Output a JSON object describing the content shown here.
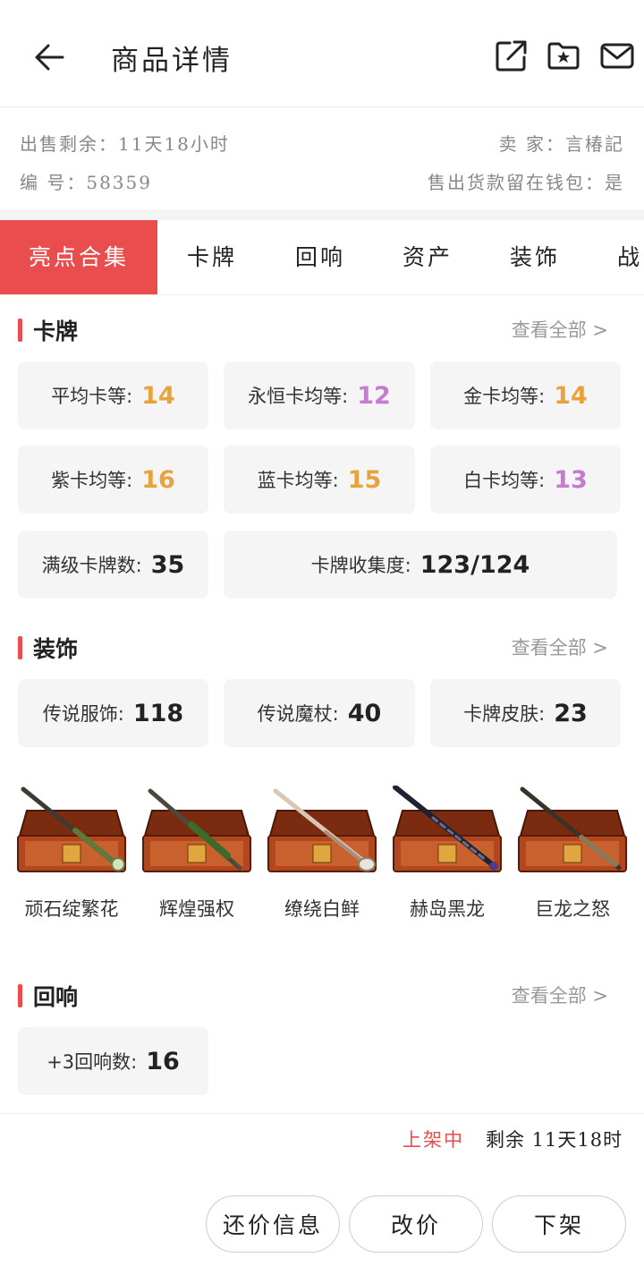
{
  "header": {
    "title": "商品详情"
  },
  "info": {
    "remaining": "出售剩余：11天18小时",
    "seller": "卖 家：言椿記",
    "number": "编 号：58359",
    "wallet": "售出货款留在钱包：是"
  },
  "tabs": [
    "亮点合集",
    "卡牌",
    "回响",
    "资产",
    "装饰",
    "战"
  ],
  "cards_section": {
    "title": "卡牌",
    "more": "查看全部 >",
    "stats": [
      {
        "label": "平均卡等:",
        "value": "14",
        "color": "#e8a33d"
      },
      {
        "label": "永恒卡均等:",
        "value": "12",
        "color": "#c67bd0"
      },
      {
        "label": "金卡均等:",
        "value": "14",
        "color": "#e8a33d"
      },
      {
        "label": "紫卡均等:",
        "value": "16",
        "color": "#e8a33d"
      },
      {
        "label": "蓝卡均等:",
        "value": "15",
        "color": "#e8a33d"
      },
      {
        "label": "白卡均等:",
        "value": "13",
        "color": "#c67bd0"
      },
      {
        "label": "满级卡牌数:",
        "value": "35"
      },
      {
        "label": "卡牌收集度:",
        "value": "123/124"
      }
    ]
  },
  "decor_section": {
    "title": "装饰",
    "more": "查看全部 >",
    "stats": [
      {
        "label": "传说服饰:",
        "value": "118"
      },
      {
        "label": "传说魔杖:",
        "value": "40"
      },
      {
        "label": "卡牌皮肤:",
        "value": "23"
      }
    ],
    "items": [
      {
        "name": "顽石绽繁花",
        "icon": "wand-chest-icon"
      },
      {
        "name": "辉煌强权",
        "icon": "wand-chest-icon"
      },
      {
        "name": "缭绕白鲜",
        "icon": "wand-chest-icon"
      },
      {
        "name": "赫岛黑龙",
        "icon": "wand-chest-icon"
      },
      {
        "name": "巨龙之怒",
        "icon": "wand-chest-icon"
      }
    ]
  },
  "echo_section": {
    "title": "回响",
    "more": "查看全部 >",
    "stats": [
      {
        "label": "+3回响数:",
        "value": "16"
      }
    ]
  },
  "footer": {
    "status": "上架中",
    "remaining": "剩余 11天18时",
    "buttons": [
      "还价信息",
      "改价",
      "下架"
    ]
  },
  "colors": {
    "accent": "#e94d4d",
    "orange": "#e8a33d",
    "purple": "#c67bd0"
  }
}
